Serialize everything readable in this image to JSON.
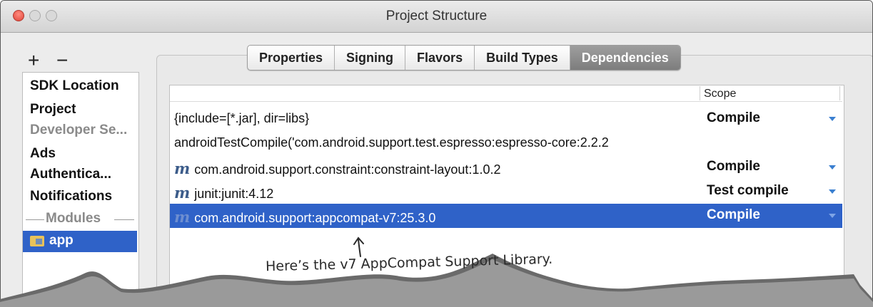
{
  "window": {
    "title": "Project Structure"
  },
  "toolbar": {
    "add_label": "+",
    "remove_label": "−"
  },
  "sidebar": {
    "items": [
      {
        "label": "SDK Location"
      },
      {
        "label": "Project"
      },
      {
        "label": "Developer Se..."
      },
      {
        "label": "Ads"
      },
      {
        "label": "Authentica..."
      },
      {
        "label": "Notifications"
      }
    ],
    "section_label": "Modules",
    "selected_module": "app"
  },
  "tabs": [
    {
      "label": "Properties"
    },
    {
      "label": "Signing"
    },
    {
      "label": "Flavors"
    },
    {
      "label": "Build Types"
    },
    {
      "label": "Dependencies",
      "active": true
    }
  ],
  "table": {
    "scope_header": "Scope",
    "rows": [
      {
        "icon": "",
        "dependency": "{include=[*.jar], dir=libs}",
        "scope": "Compile"
      },
      {
        "icon": "",
        "dependency": "androidTestCompile('com.android.support.test.espresso:espresso-core:2.2.2",
        "scope": ""
      },
      {
        "icon": "m",
        "dependency": "com.android.support.constraint:constraint-layout:1.0.2",
        "scope": "Compile"
      },
      {
        "icon": "m",
        "dependency": "junit:junit:4.12",
        "scope": "Test compile"
      },
      {
        "icon": "m",
        "dependency": "com.android.support:appcompat-v7:25.3.0",
        "scope": "Compile",
        "selected": true
      }
    ]
  },
  "annotation": "Here’s the v7 AppCompat Support Library.",
  "colors": {
    "selection": "#2f62c8",
    "close_button": "#e0443a",
    "active_tab": "#8a8a8a"
  }
}
